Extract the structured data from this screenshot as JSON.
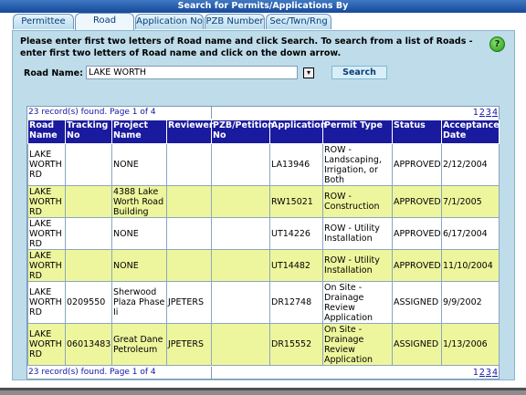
{
  "window": {
    "title": "Search for Permits/Applications By"
  },
  "tabs": [
    {
      "label": "Permittee"
    },
    {
      "label": "Road"
    },
    {
      "label": "Application No"
    },
    {
      "label": "PZB Number"
    },
    {
      "label": "Sec/Twn/Rng"
    }
  ],
  "search": {
    "instructions": "Please enter first two letters of Road name and click Search. To search from a list of Roads - enter first two letters of Road name and click on the down arrow.",
    "help_icon": "?",
    "road_label": "Road Name:",
    "road_value": "LAKE WORTH",
    "dropdown_icon": "▾",
    "search_button": "Search"
  },
  "results": {
    "record_count": "23 record(s) found. Page 1 of 4",
    "pages": [
      "1",
      "2",
      "3",
      "4"
    ],
    "columns": [
      "Road Name",
      "Tracking No",
      "Project Name",
      "Reviewer",
      "PZB/Petition No",
      "Application",
      "Permit Type",
      "Status",
      "Acceptance Date"
    ],
    "rows": [
      {
        "road_name": "LAKE WORTH RD",
        "tracking_no": "",
        "project_name": "NONE",
        "reviewer": "",
        "pzb_petition_no": "",
        "application": "LA13946",
        "permit_type": "ROW - Landscaping, Irrigation, or Both",
        "status": "APPROVED",
        "acceptance_date": "2/12/2004"
      },
      {
        "road_name": "LAKE WORTH RD",
        "tracking_no": "",
        "project_name": "4388 Lake Worth Road Building",
        "reviewer": "",
        "pzb_petition_no": "",
        "application": "RW15021",
        "permit_type": "ROW - Construction",
        "status": "APPROVED",
        "acceptance_date": "7/1/2005"
      },
      {
        "road_name": "LAKE WORTH RD",
        "tracking_no": "",
        "project_name": "NONE",
        "reviewer": "",
        "pzb_petition_no": "",
        "application": "UT14226",
        "permit_type": "ROW - Utility Installation",
        "status": "APPROVED",
        "acceptance_date": "6/17/2004"
      },
      {
        "road_name": "LAKE WORTH RD",
        "tracking_no": "",
        "project_name": "NONE",
        "reviewer": "",
        "pzb_petition_no": "",
        "application": "UT14482",
        "permit_type": "ROW - Utility Installation",
        "status": "APPROVED",
        "acceptance_date": "11/10/2004"
      },
      {
        "road_name": "LAKE WORTH RD",
        "tracking_no": "0209550",
        "project_name": "Sherwood Plaza Phase Ii",
        "reviewer": "JPETERS",
        "pzb_petition_no": "",
        "application": "DR12748",
        "permit_type": "On Site - Drainage Review Application",
        "status": "ASSIGNED",
        "acceptance_date": "9/9/2002"
      },
      {
        "road_name": "LAKE WORTH RD",
        "tracking_no": "06013483",
        "project_name": "Great Dane Petroleum",
        "reviewer": "JPETERS",
        "pzb_petition_no": "",
        "application": "DR15552",
        "permit_type": "On Site - Drainage Review Application",
        "status": "ASSIGNED",
        "acceptance_date": "1/13/2006"
      }
    ]
  },
  "colors": {
    "title_bar": "#15499a",
    "panel_bg": "#bedcea",
    "header_bg": "#1a1a9e",
    "row_alt_bg": "#eef69d",
    "link_text": "#1414a8"
  }
}
